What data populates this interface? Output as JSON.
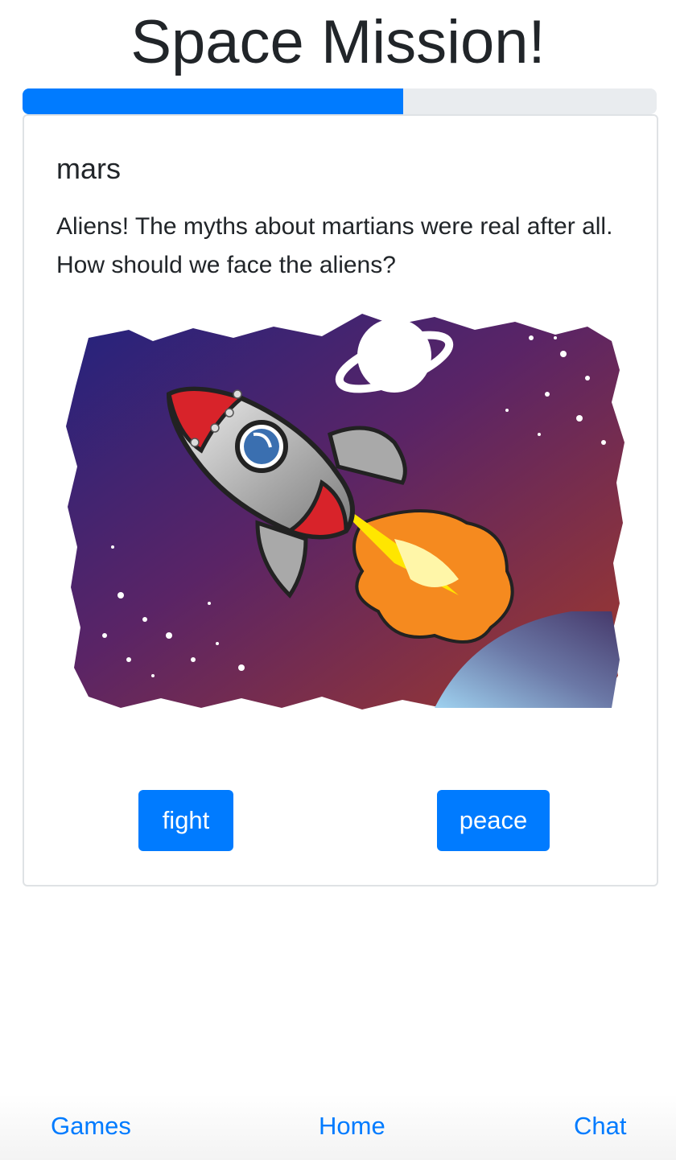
{
  "header": {
    "title": "Space Mission!"
  },
  "progress": {
    "fraction": 0.6,
    "color": "#007bff"
  },
  "card": {
    "title": "mars",
    "text": "Aliens! The myths about martians were real after all. How should we face the aliens?",
    "image_icon": "rocket-illustration"
  },
  "choices": {
    "fight_label": "fight",
    "peace_label": "peace"
  },
  "nav": {
    "games": "Games",
    "home": "Home",
    "chat": "Chat"
  },
  "colors": {
    "accent": "#007bff",
    "text": "#212529"
  }
}
